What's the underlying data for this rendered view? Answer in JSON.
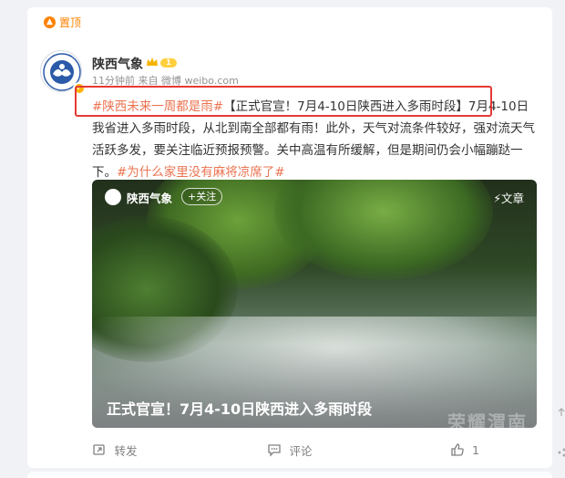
{
  "pinned": {
    "label": "置顶"
  },
  "post": {
    "author": "陕西气象",
    "level": "1",
    "meta": "11分钟前 来自 微博 weibo.com",
    "topic1": "#陕西未来一周都是雨#",
    "headline": "【正式官宣！7月4-10日陕西进入多雨时段】",
    "body": "7月4-10日我省进入多雨时段，从北到南全部都有雨！此外，天气对流条件较好，强对流天气活跃多发，要关注临近预报预警。关中高温有所缓解，但是期间仍会小幅蹦跶一下。",
    "topic2": "#为什么家里没有麻将凉席了#"
  },
  "media": {
    "name": "陕西气象",
    "follow": "+关注",
    "article": "文章",
    "title": "正式官宣！7月4-10日陕西进入多雨时段",
    "watermark": "荣耀渭南"
  },
  "actions": {
    "repost": "转发",
    "comment": "评论",
    "like": "1"
  },
  "colors": {
    "accent": "#ff8200",
    "topic": "#eb7350",
    "highlight": "#e53935"
  }
}
